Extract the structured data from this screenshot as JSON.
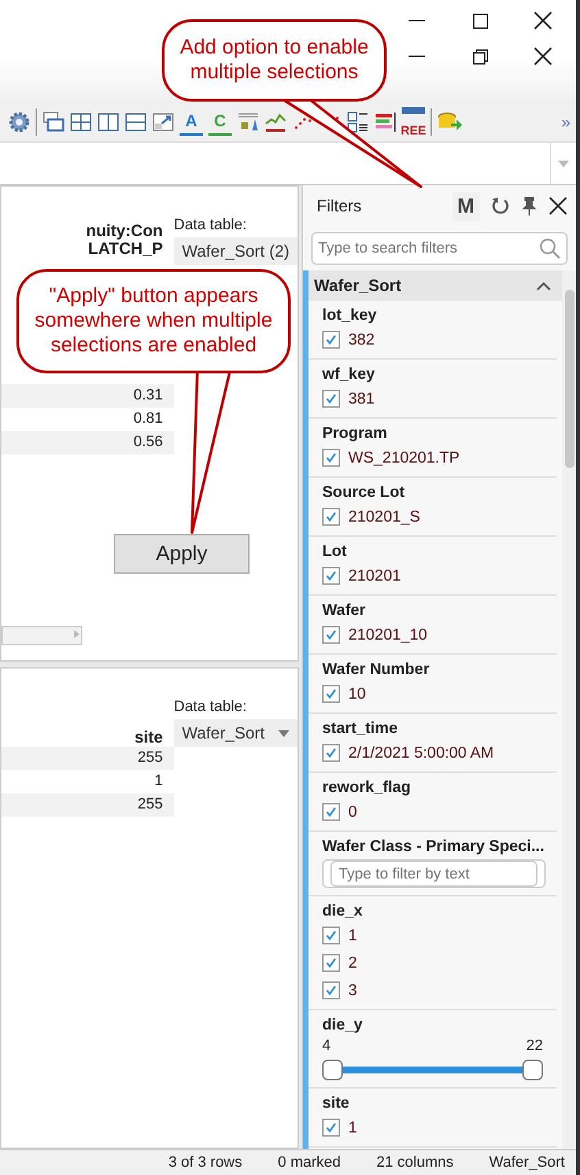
{
  "toolbar": {
    "items": [
      {
        "kind": "gear"
      },
      {
        "kind": "sep"
      },
      {
        "kind": "windows"
      },
      {
        "kind": "grid"
      },
      {
        "kind": "cols"
      },
      {
        "kind": "rows"
      },
      {
        "kind": "expand"
      },
      {
        "kind": "letter",
        "label": "A",
        "color": "#1f7bd1"
      },
      {
        "kind": "letter",
        "label": "C",
        "color": "#3aa53a"
      },
      {
        "kind": "box"
      },
      {
        "kind": "line"
      },
      {
        "kind": "scatter"
      },
      {
        "kind": "scatter2"
      },
      {
        "kind": "matrix"
      },
      {
        "kind": "bars"
      },
      {
        "kind": "tree",
        "label": "REE"
      },
      {
        "kind": "sep"
      },
      {
        "kind": "export"
      }
    ],
    "overflow": "»"
  },
  "top_panel": {
    "headers": [
      "nuity:Con",
      "LATCH_P"
    ],
    "values": [
      "0.31",
      "0.81",
      "0.56"
    ],
    "data_table_label": "Data table:",
    "data_table": "Wafer_Sort (2)",
    "apply_button": "Apply"
  },
  "bottom_panel": {
    "data_table_label": "Data table:",
    "data_table": "Wafer_Sort",
    "column": "site",
    "values": [
      "255",
      "1",
      "255"
    ]
  },
  "filters": {
    "title": "Filters",
    "multi_button": "M",
    "search_placeholder": "Type to search filters",
    "section": {
      "title": "Wafer_Sort",
      "expanded": true
    },
    "items": [
      {
        "kind": "checklist",
        "name": "lot_key",
        "options": [
          {
            "label": "382",
            "checked": true
          }
        ]
      },
      {
        "kind": "checklist",
        "name": "wf_key",
        "options": [
          {
            "label": "381",
            "checked": true
          }
        ]
      },
      {
        "kind": "checklist",
        "name": "Program",
        "options": [
          {
            "label": "WS_210201.TP",
            "checked": true
          }
        ]
      },
      {
        "kind": "checklist",
        "name": "Source Lot",
        "options": [
          {
            "label": "210201_S",
            "checked": true
          }
        ]
      },
      {
        "kind": "checklist",
        "name": "Lot",
        "options": [
          {
            "label": "210201",
            "checked": true
          }
        ]
      },
      {
        "kind": "checklist",
        "name": "Wafer",
        "options": [
          {
            "label": "210201_10",
            "checked": true
          }
        ]
      },
      {
        "kind": "checklist",
        "name": "Wafer Number",
        "options": [
          {
            "label": "10",
            "checked": true
          }
        ]
      },
      {
        "kind": "checklist",
        "name": "start_time",
        "options": [
          {
            "label": "2/1/2021 5:00:00 AM",
            "checked": true
          }
        ]
      },
      {
        "kind": "checklist",
        "name": "rework_flag",
        "options": [
          {
            "label": "0",
            "checked": true
          }
        ]
      },
      {
        "kind": "text",
        "name": "Wafer Class - Primary Speci...",
        "placeholder": "Type to filter by text"
      },
      {
        "kind": "checklist",
        "name": "die_x",
        "options": [
          {
            "label": "1",
            "checked": true
          },
          {
            "label": "2",
            "checked": true
          },
          {
            "label": "3",
            "checked": true
          }
        ]
      },
      {
        "kind": "range",
        "name": "die_y",
        "min": "4",
        "max": "22",
        "level": 1
      },
      {
        "kind": "checklist",
        "name": "site",
        "options": [
          {
            "label": "1",
            "checked": true
          }
        ]
      }
    ]
  },
  "status_bar": [
    "3 of 3 rows",
    "0 marked",
    "21 columns",
    "Wafer_Sort"
  ],
  "callouts": [
    {
      "text": "Add option to enable  multiple selections"
    },
    {
      "text": "\"Apply\" button appears somewhere when multiple selections are enabled"
    }
  ]
}
